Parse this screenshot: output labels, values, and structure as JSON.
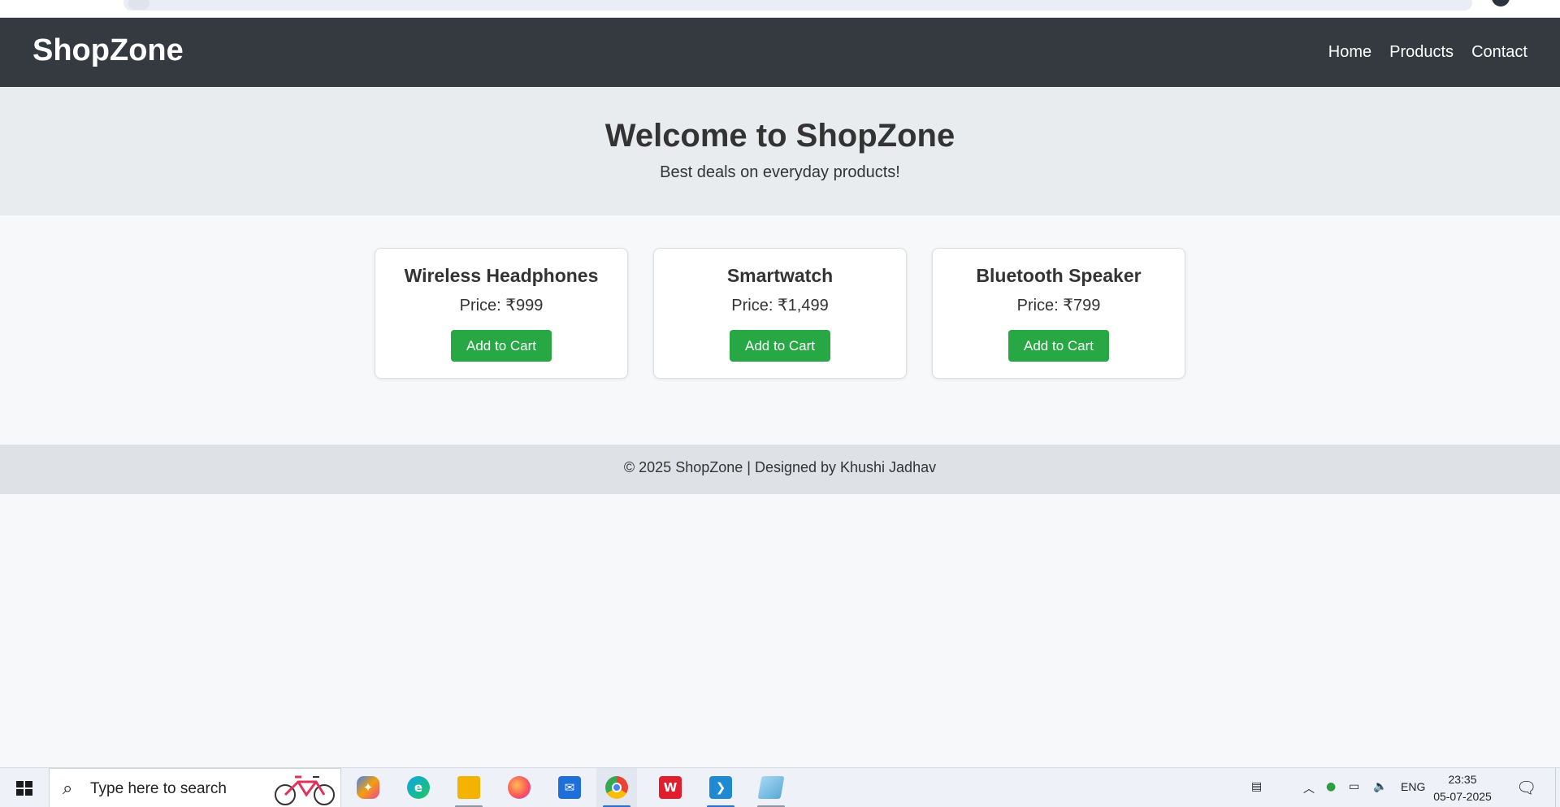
{
  "site": {
    "logo": "ShopZone",
    "nav": [
      "Home",
      "Products",
      "Contact"
    ]
  },
  "hero": {
    "title": "Welcome to ShopZone",
    "subtitle": "Best deals on everyday products!"
  },
  "products": [
    {
      "name": "Wireless Headphones",
      "price": "Price: ₹999",
      "button": "Add to Cart"
    },
    {
      "name": "Smartwatch",
      "price": "Price: ₹1,499",
      "button": "Add to Cart"
    },
    {
      "name": "Bluetooth Speaker",
      "price": "Price: ₹799",
      "button": "Add to Cart"
    }
  ],
  "footer": {
    "text": "© 2025 ShopZone | Designed by Khushi Jadhav"
  },
  "taskbar": {
    "search_placeholder": "Type here to search",
    "apps": [
      "copilot-icon",
      "edge-icon",
      "file-explorer-icon",
      "firefox-icon",
      "mail-icon",
      "chrome-icon",
      "wps-icon",
      "vscode-icon",
      "app-icon"
    ],
    "tray": {
      "language": "ENG",
      "time": "23:35",
      "date": "05-07-2025"
    }
  },
  "colors": {
    "header_bg": "#343a40",
    "hero_bg": "#e9ecef",
    "button_green": "#28a745",
    "footer_bg": "#dee2e6",
    "page_bg": "#f7f8fa"
  }
}
